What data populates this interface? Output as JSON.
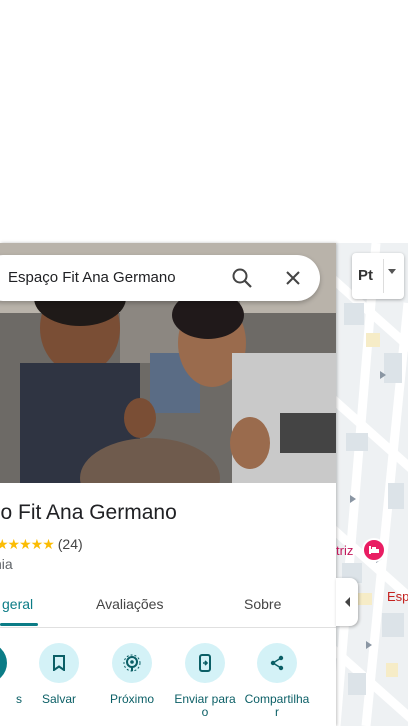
{
  "search": {
    "text": "Espaço Fit Ana Germano"
  },
  "place": {
    "title": "ço Fit Ana Germano",
    "stars": "★★★★★",
    "review_count": "(24)",
    "category": "nia"
  },
  "tabs": [
    {
      "label": "geral"
    },
    {
      "label": "Avaliações"
    },
    {
      "label": "Sobre"
    }
  ],
  "actions": [
    {
      "label": "s",
      "icon": "directions-icon"
    },
    {
      "label": "Salvar",
      "icon": "bookmark-icon"
    },
    {
      "label": "Próximo",
      "icon": "nearby-icon"
    },
    {
      "label": "Enviar para o",
      "icon": "send-to-phone-icon"
    },
    {
      "label": "Compartilha r",
      "icon": "share-icon"
    }
  ],
  "map": {
    "layer_label": "Pt",
    "label_1": "triz",
    "label_2": "Esp"
  },
  "colors": {
    "accent": "#0b7c86",
    "chip_bg": "#d4f2f7",
    "star": "#fbbc04",
    "hotel_pin": "#e91e63"
  }
}
